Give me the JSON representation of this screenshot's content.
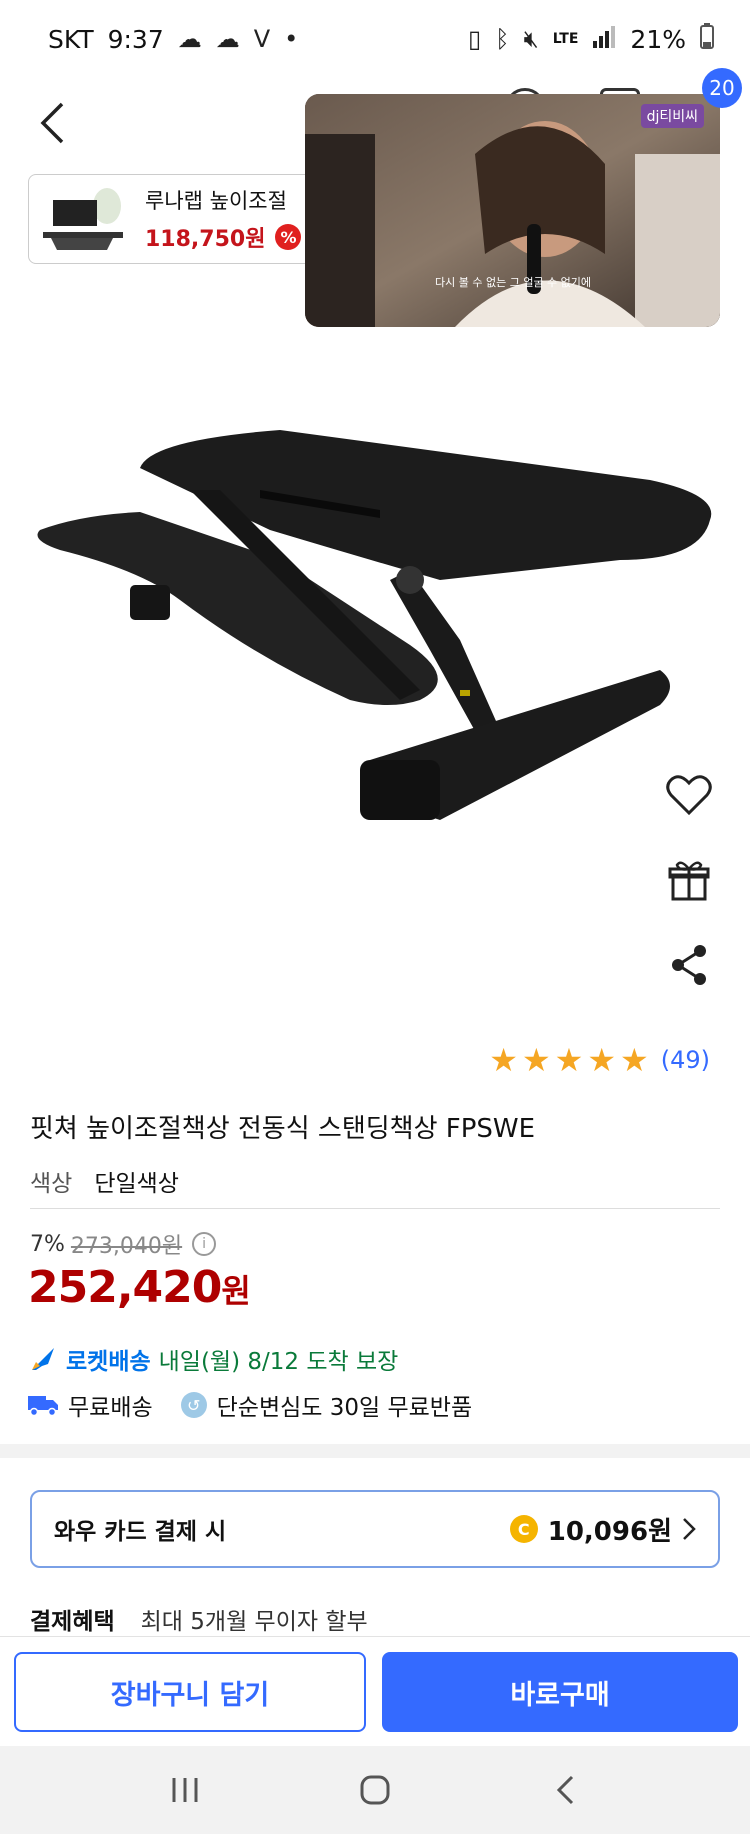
{
  "status_bar": {
    "carrier": "SKT",
    "time": "9:37",
    "network": "LTE",
    "battery": "21%"
  },
  "nav": {
    "cart_count": "20"
  },
  "related": {
    "title": "루나랩 높이조절",
    "price": "118,750원",
    "badge": "%"
  },
  "video": {
    "caption": "다시 볼 수 없는 그 얼굴 수 없기에",
    "channel": "dj티비씨"
  },
  "product": {
    "rating_count": "(49)",
    "stars": 5,
    "title": "핏쳐 높이조절책상 전동식 스탠딩책상 FPSWE",
    "option_label": "색상",
    "option_value": "단일색상",
    "discount_pct": "7%",
    "original_price": "273,040원",
    "sale_price_num": "252,420",
    "sale_price_unit": "원"
  },
  "delivery": {
    "rocket_label": "로켓배송",
    "arrival": "내일(월) 8/12 도착 보장",
    "free_shipping": "무료배송",
    "return_policy": "단순변심도 30일 무료반품"
  },
  "wow": {
    "label": "와우 카드 결제 시",
    "coin": "C",
    "amount": "10,096원"
  },
  "benefit": {
    "label": "결제혜택",
    "value": "최대 5개월 무이자 할부"
  },
  "actions": {
    "cart_button": "장바구니 담기",
    "buy_button": "바로구매"
  },
  "colors": {
    "primary": "#346aff",
    "sale": "#ae0000",
    "star": "#f5a623"
  }
}
